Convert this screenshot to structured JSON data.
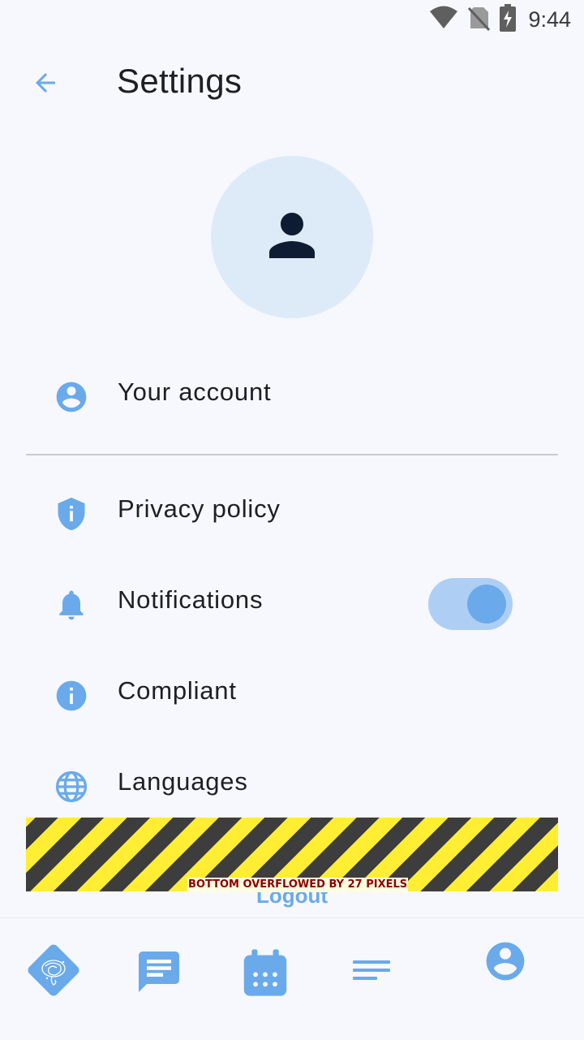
{
  "status_bar": {
    "time": "9:44",
    "icons": [
      "wifi-icon",
      "no-sim-icon",
      "battery-charging-icon"
    ]
  },
  "app_bar": {
    "back_icon": "arrow-back-icon",
    "title": "Settings"
  },
  "profile": {
    "avatar_icon": "person-icon"
  },
  "menu": {
    "your_account": "Your account",
    "privacy_policy": "Privacy policy",
    "notifications": "Notifications",
    "notifications_enabled": true,
    "compliant": "Compliant",
    "languages": "Languages"
  },
  "logout_label": "Logout",
  "overflow_warning": "BOTTOM OVERFLOWED BY 27 PIXELS",
  "bottom_nav": {
    "items": [
      "logo-icon",
      "chat-icon",
      "calendar-icon",
      "menu-lines-icon",
      "profile-icon"
    ]
  },
  "colors": {
    "accent": "#6aaaeb",
    "background": "#f6f8fd",
    "avatar_bg": "#ddebf8",
    "avatar_icon": "#0e1c33"
  }
}
